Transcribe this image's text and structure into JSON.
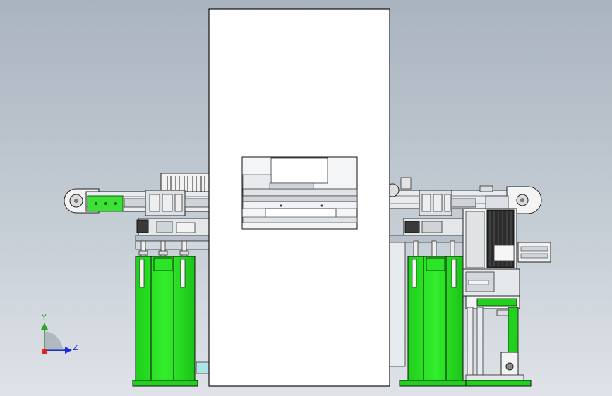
{
  "view": {
    "background_top": "#aab4bf",
    "background_bottom": "#dfe3e8"
  },
  "colors": {
    "frame_green": "#22e01e",
    "frame_green_dark": "#0f7f0c",
    "part_outline": "#1b1b1b",
    "panel_white": "#ffffff",
    "metal_light": "#e8ebee",
    "metal_mid": "#b9c0c7",
    "dark_block": "#2c2c2c",
    "light_cyan": "#aee4e8"
  },
  "triad": {
    "y_label": "Y",
    "z_label": "Z",
    "y_color": "#2aa52a",
    "z_color": "#1f2fd8",
    "origin_color": "#e0241b"
  }
}
